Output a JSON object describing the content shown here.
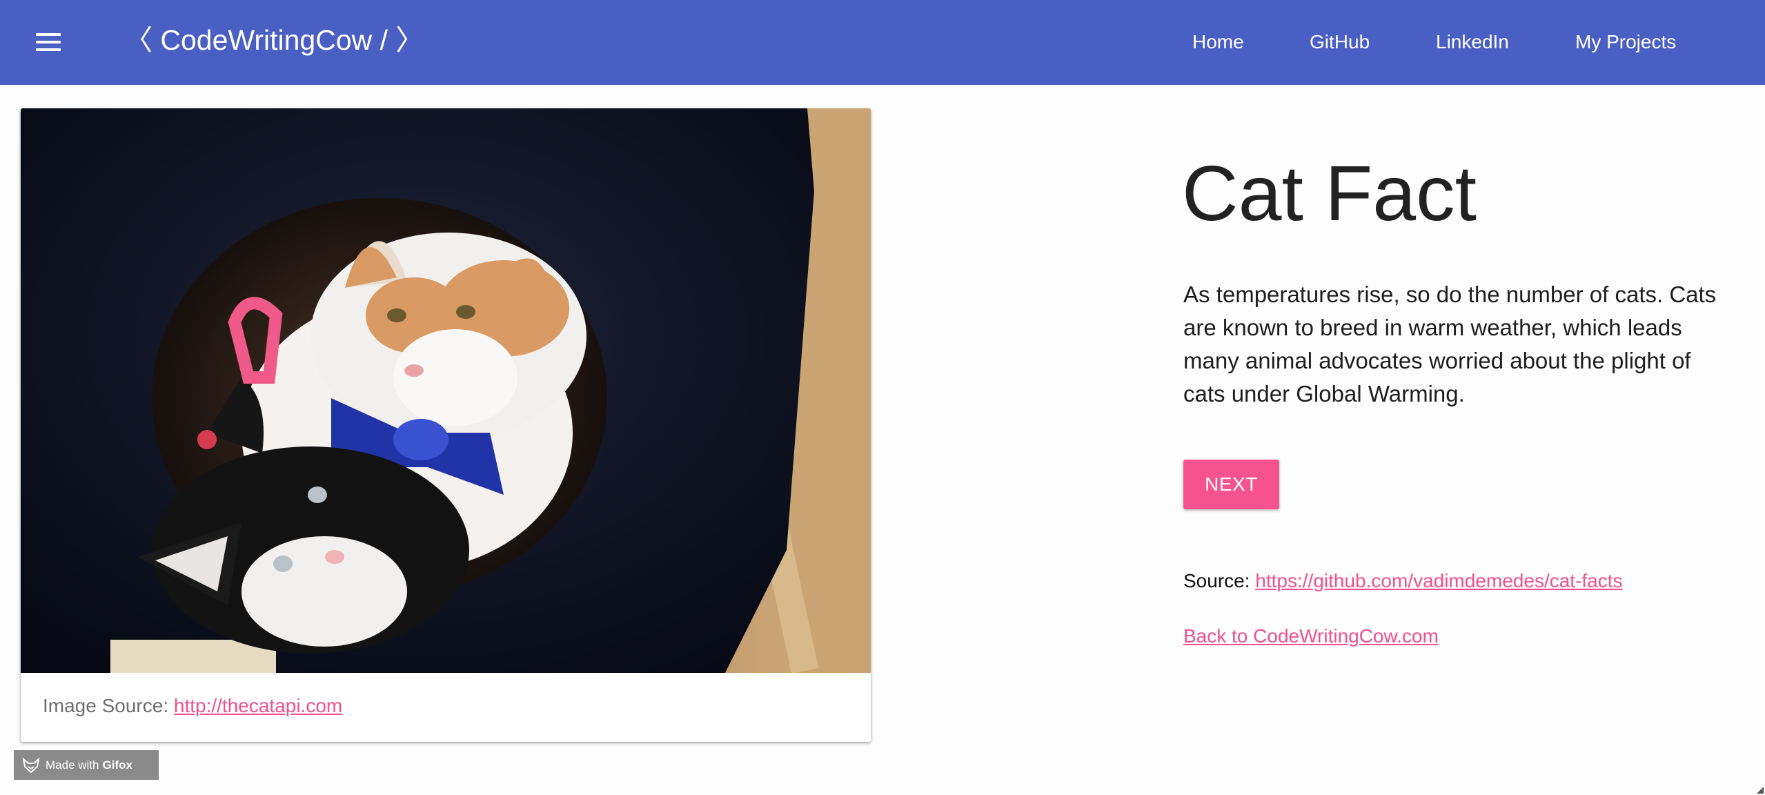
{
  "header": {
    "brand": "〈 CodeWritingCow / 〉",
    "nav": [
      "Home",
      "GitHub",
      "LinkedIn",
      "My Projects"
    ],
    "color": "#4a5fc4"
  },
  "card": {
    "image_alt": "Two cats lying in a cat tree hole",
    "image_source_label": "Image Source: ",
    "image_source_link": "http://thecatapi.com"
  },
  "main": {
    "title": "Cat Fact",
    "fact": "As temperatures rise, so do the number of cats. Cats are known to breed in warm weather, which leads many animal advocates worried about the plight of cats under Global Warming.",
    "next_label": "NEXT",
    "source_label": "Source: ",
    "source_link": "https://github.com/vadimdemedes/cat-facts",
    "back_link": "Back to CodeWritingCow.com",
    "accent": "#f5528e"
  },
  "watermark": {
    "prefix": "Made with",
    "brand": "Gifox"
  }
}
